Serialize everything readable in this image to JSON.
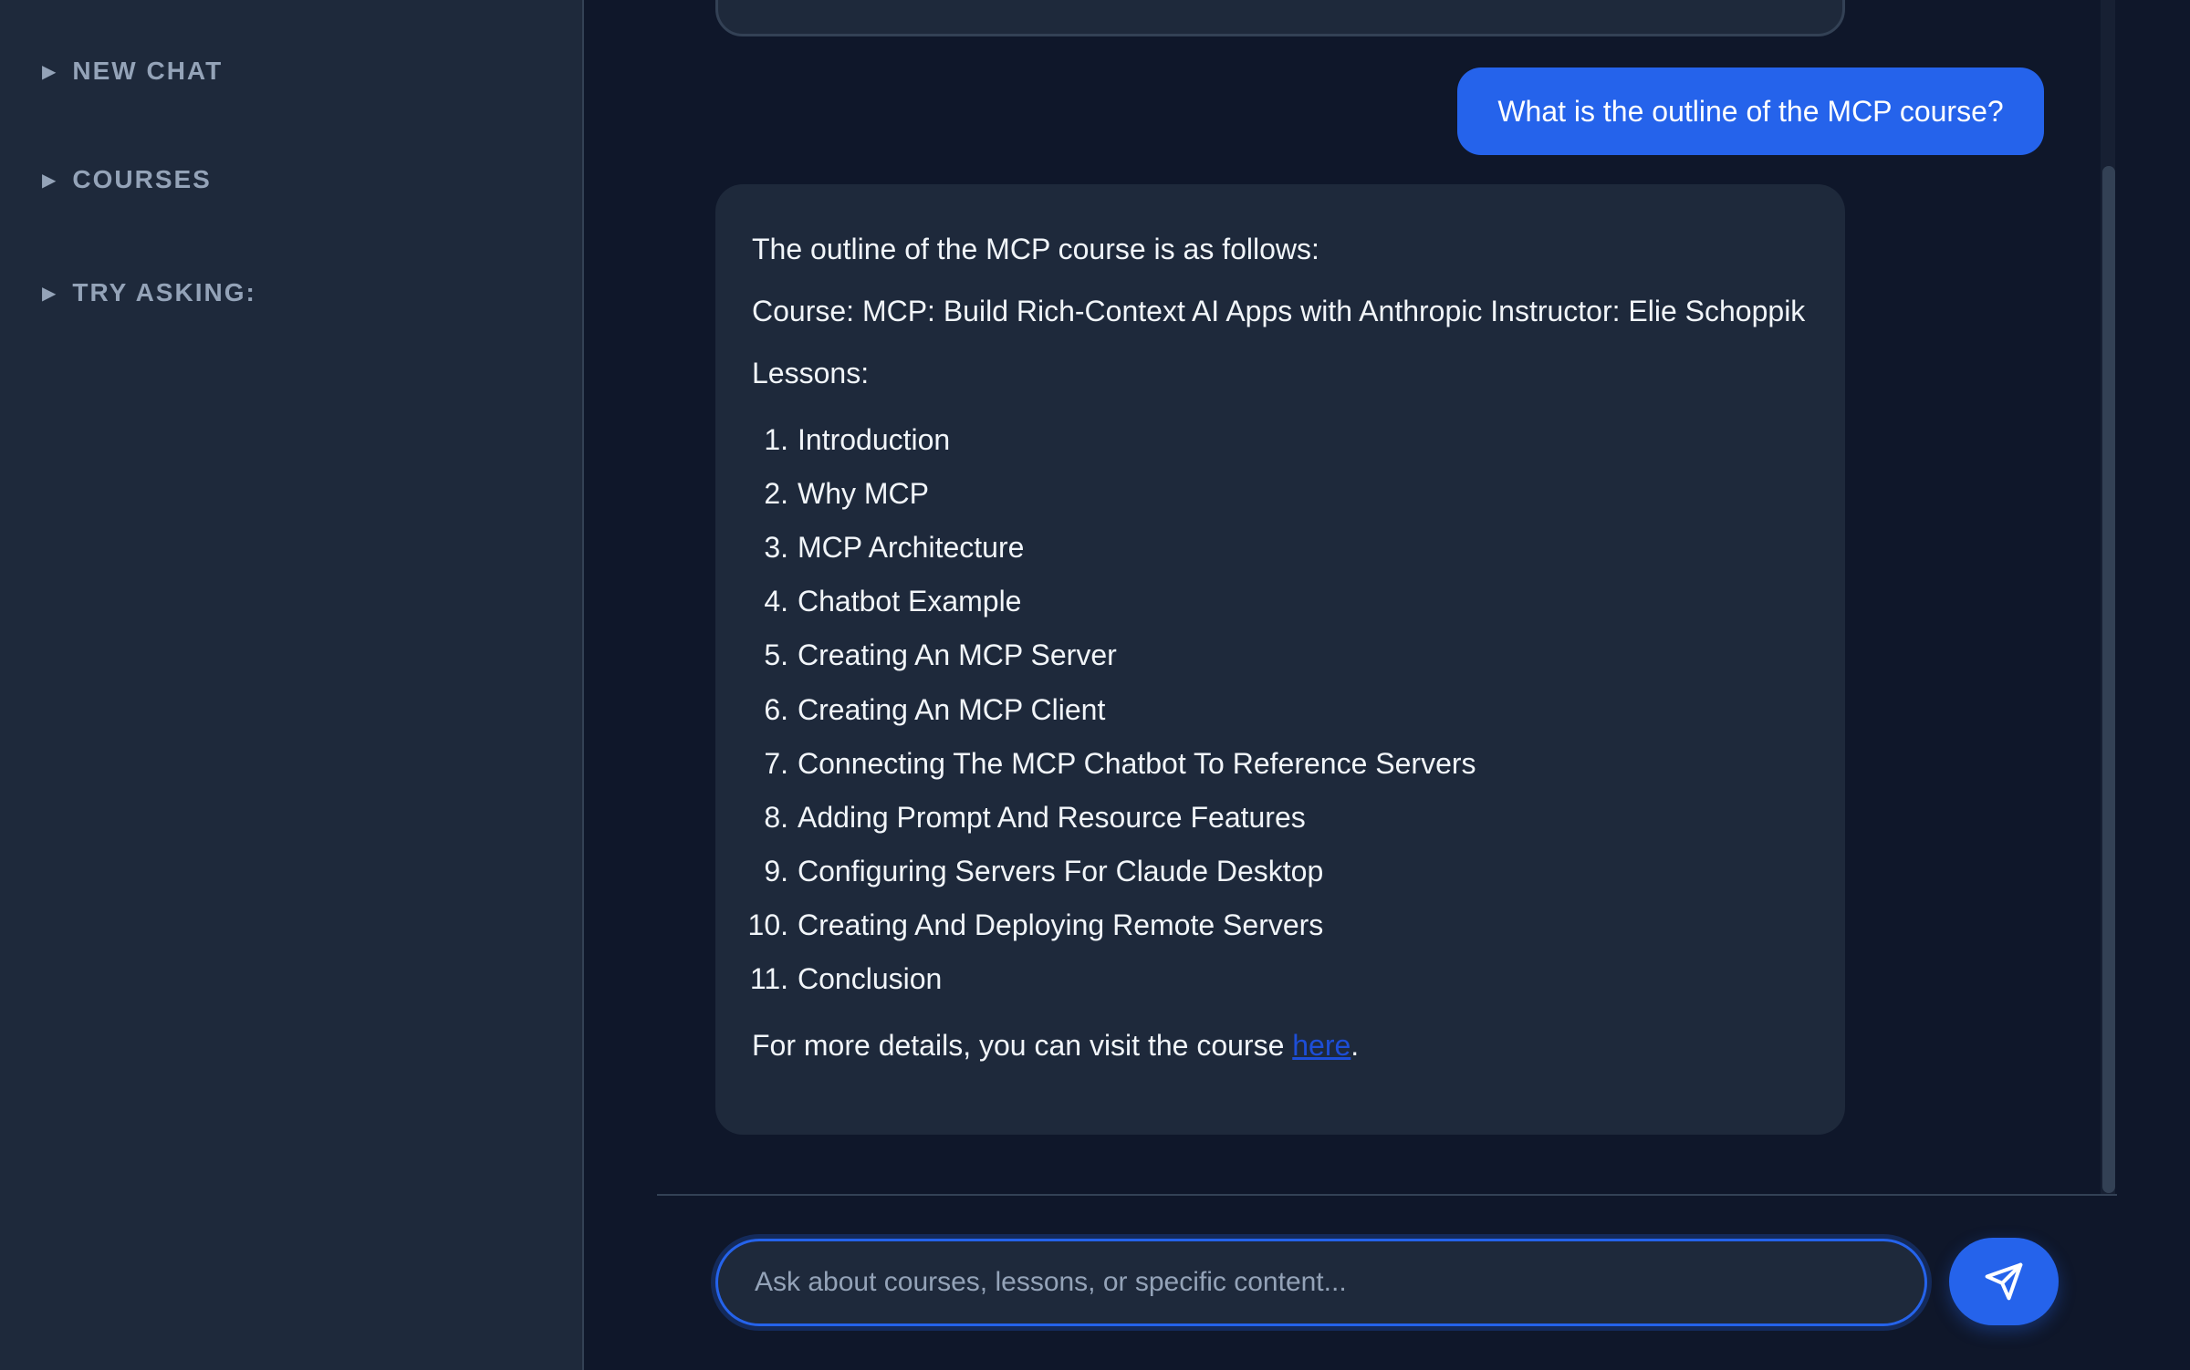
{
  "sidebar": {
    "items": [
      {
        "label": "NEW CHAT"
      },
      {
        "label": "COURSES"
      },
      {
        "label": "TRY ASKING:"
      }
    ]
  },
  "chat": {
    "user_message": "What is the outline of the MCP course?",
    "assistant": {
      "intro": "The outline of the MCP course is as follows:",
      "course_line": "Course: MCP: Build Rich-Context AI Apps with Anthropic Instructor: Elie Schoppik",
      "lessons_heading": "Lessons:",
      "lessons": [
        {
          "num": "1.",
          "title": "Introduction"
        },
        {
          "num": "2.",
          "title": "Why MCP"
        },
        {
          "num": "3.",
          "title": "MCP Architecture"
        },
        {
          "num": "4.",
          "title": "Chatbot Example"
        },
        {
          "num": "5.",
          "title": "Creating An MCP Server"
        },
        {
          "num": "6.",
          "title": "Creating An MCP Client"
        },
        {
          "num": "7.",
          "title": "Connecting The MCP Chatbot To Reference Servers"
        },
        {
          "num": "8.",
          "title": "Adding Prompt And Resource Features"
        },
        {
          "num": "9.",
          "title": "Configuring Servers For Claude Desktop"
        },
        {
          "num": "10.",
          "title": "Creating And Deploying Remote Servers"
        },
        {
          "num": "11.",
          "title": "Conclusion"
        }
      ],
      "footer_text": "For more details, you can visit the course ",
      "link_text": "here",
      "footer_end": "."
    }
  },
  "input": {
    "placeholder": "Ask about courses, lessons, or specific content...",
    "value": ""
  },
  "icons": {
    "sidebar_toggle": "triangle-right-icon",
    "send": "send-icon"
  },
  "colors": {
    "accent": "#2563eb",
    "background": "#0f172a",
    "surface": "#1e293b",
    "muted_text": "#94a3b8"
  }
}
